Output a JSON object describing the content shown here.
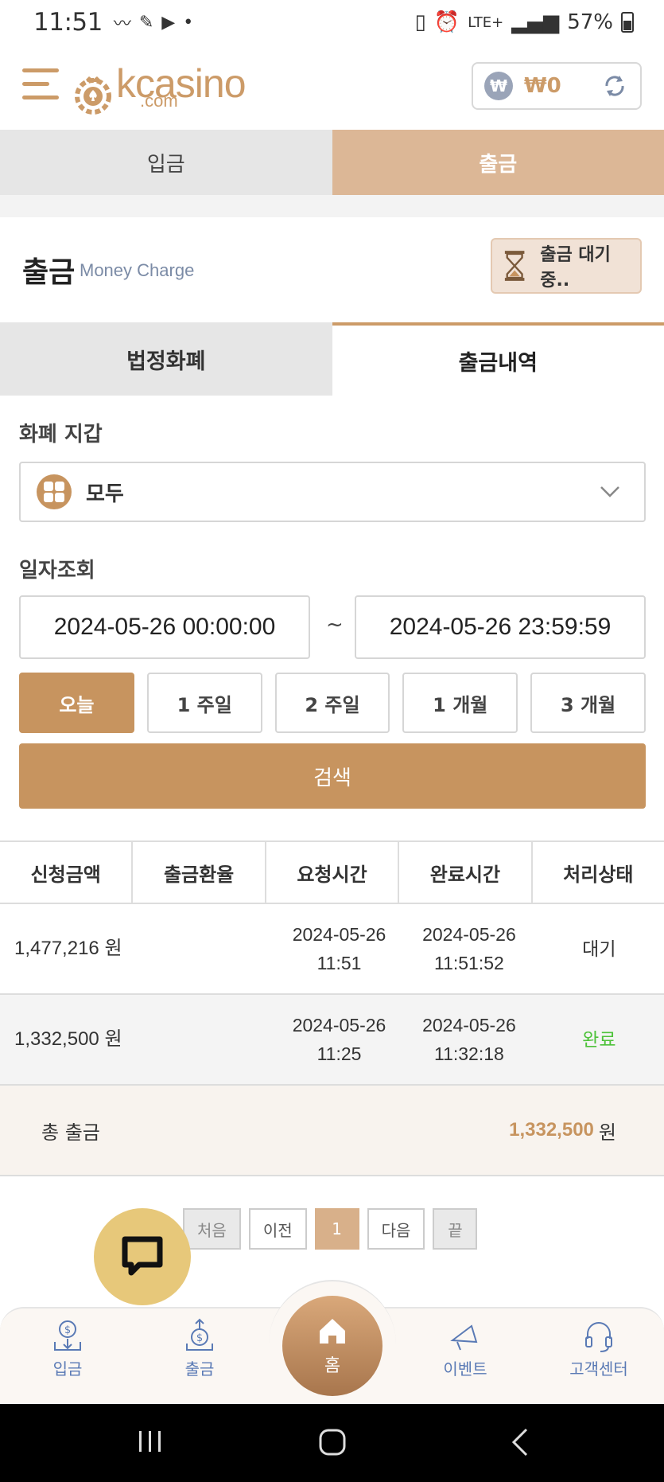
{
  "status_bar": {
    "time": "11:51",
    "network": "LTE+",
    "battery": "57%"
  },
  "header": {
    "logo_text": "kcasino",
    "logo_sub": ".com",
    "balance": "₩0",
    "won_symbol": "₩"
  },
  "top_tabs": [
    {
      "label": "입금",
      "active": false
    },
    {
      "label": "출금",
      "active": true
    }
  ],
  "section": {
    "title": "출금",
    "subtitle": "Money Charge",
    "wait_button": "출금 대기 중.."
  },
  "sub_tabs": [
    {
      "label": "법정화폐",
      "active": false
    },
    {
      "label": "출금내역",
      "active": true
    }
  ],
  "wallet": {
    "label": "화폐 지갑",
    "selected": "모두"
  },
  "date_query": {
    "label": "일자조회",
    "start": "2024-05-26 00:00:00",
    "separator": "~",
    "end": "2024-05-26 23:59:59"
  },
  "periods": [
    {
      "label": "오늘",
      "active": true
    },
    {
      "label": "1 주일",
      "active": false
    },
    {
      "label": "2 주일",
      "active": false
    },
    {
      "label": "1 개월",
      "active": false
    },
    {
      "label": "3 개월",
      "active": false
    }
  ],
  "search_label": "검색",
  "table": {
    "headers": [
      "신청금액",
      "출금환율",
      "요청시간",
      "완료시간",
      "처리상태"
    ],
    "rows": [
      {
        "amount": "1,477,216 원",
        "rate": "",
        "req_date": "2024-05-26",
        "req_time": "11:51",
        "done_date": "2024-05-26",
        "done_time": "11:51:52",
        "status": "대기"
      },
      {
        "amount": "1,332,500 원",
        "rate": "",
        "req_date": "2024-05-26",
        "req_time": "11:25",
        "done_date": "2024-05-26",
        "done_time": "11:32:18",
        "status": "완료"
      }
    ],
    "total_label": "총 출금",
    "total_value": "1,332,500",
    "total_unit": "원"
  },
  "pagination": {
    "first": "처음",
    "prev": "이전",
    "current": "1",
    "next": "다음",
    "last": "끝"
  },
  "bottom_nav": {
    "deposit": "입금",
    "withdraw": "출금",
    "home": "홈",
    "event": "이벤트",
    "support": "고객센터"
  },
  "colors": {
    "accent": "#c7945f",
    "tab_active": "#dcb796",
    "status_done": "#4ec23a",
    "nav_text": "#5a7ab5"
  }
}
